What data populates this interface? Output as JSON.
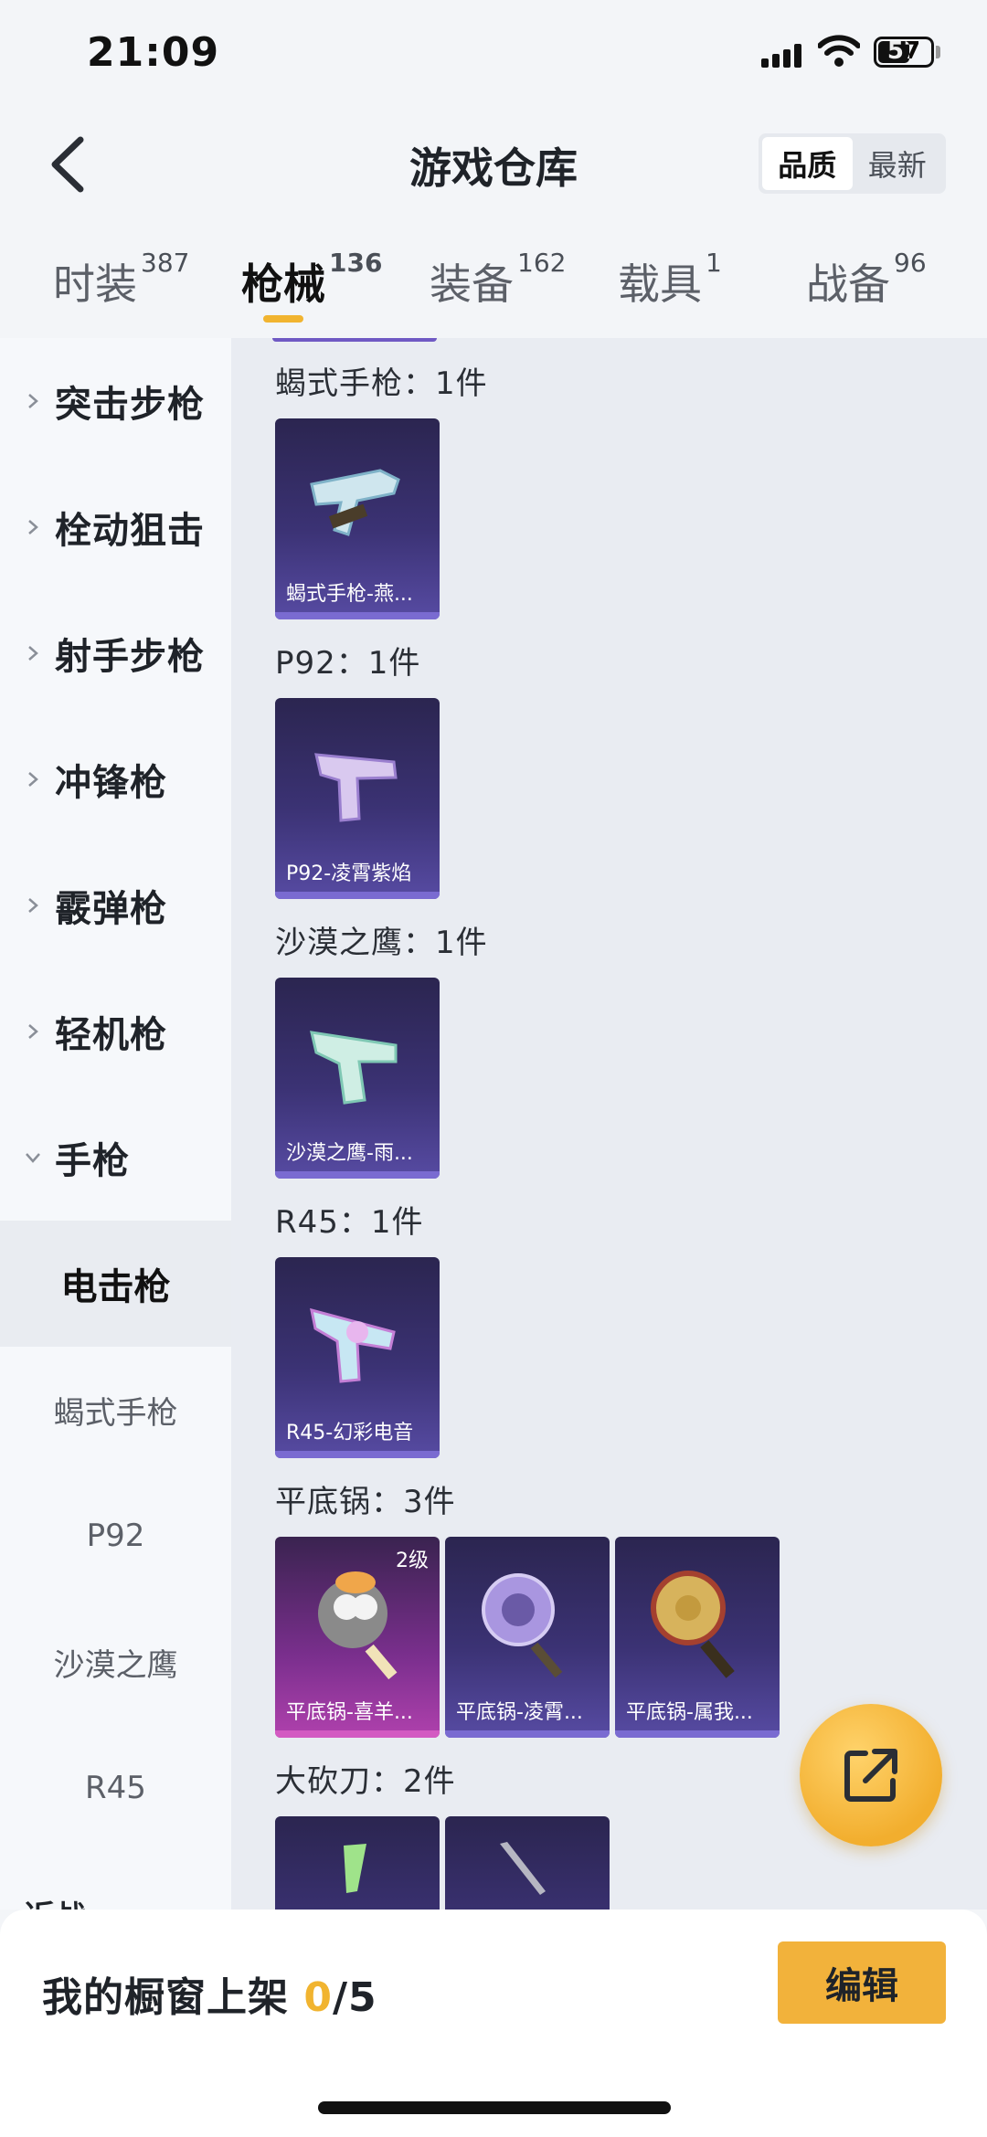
{
  "status_bar": {
    "time": "21:09",
    "battery": "57"
  },
  "header": {
    "title": "游戏仓库",
    "sort_options": [
      "品质",
      "最新"
    ],
    "sort_active": "品质"
  },
  "tabs": [
    {
      "label": "时装",
      "count": "387"
    },
    {
      "label": "枪械",
      "count": "136",
      "active": true
    },
    {
      "label": "装备",
      "count": "162"
    },
    {
      "label": "载具",
      "count": "1"
    },
    {
      "label": "战备",
      "count": "96"
    }
  ],
  "sidebar": {
    "categories": [
      "突击步枪",
      "栓动狙击",
      "射手步枪",
      "冲锋枪",
      "霰弹枪",
      "轻机枪",
      "手枪"
    ],
    "active_item": "电击枪",
    "sub_items": [
      "蝎式手枪",
      "P92",
      "沙漠之鹰",
      "R45",
      "近战"
    ]
  },
  "groups": [
    {
      "title": "蝎式手枪：1件",
      "items": [
        {
          "name": "蝎式手枪-燕...",
          "icon": "smg-icon"
        }
      ]
    },
    {
      "title": "P92：1件",
      "items": [
        {
          "name": "P92-凌霄紫焰",
          "icon": "pistol-icon"
        }
      ]
    },
    {
      "title": "沙漠之鹰：1件",
      "items": [
        {
          "name": "沙漠之鹰-雨...",
          "icon": "pistol-icon"
        }
      ]
    },
    {
      "title": "R45：1件",
      "items": [
        {
          "name": "R45-幻彩电音",
          "icon": "revolver-icon"
        }
      ]
    },
    {
      "title": "平底锅：3件",
      "items": [
        {
          "name": "平底锅-喜羊...",
          "icon": "pan-icon",
          "level": "2级"
        },
        {
          "name": "平底锅-凌霄...",
          "icon": "pan-icon"
        },
        {
          "name": "平底锅-属我...",
          "icon": "pan-icon"
        }
      ]
    },
    {
      "title": "大砍刀：2件",
      "items": [
        {
          "name": "",
          "icon": "machete-icon"
        },
        {
          "name": "",
          "icon": "machete-icon"
        }
      ]
    }
  ],
  "shelf": {
    "label": "我的橱窗上架",
    "current": "0",
    "separator": "/",
    "total": "5"
  },
  "edit_button": "编辑",
  "colors": {
    "accent": "#f1b430",
    "card_purple": "#3b3274",
    "card_pink": "#7b2f8e"
  }
}
